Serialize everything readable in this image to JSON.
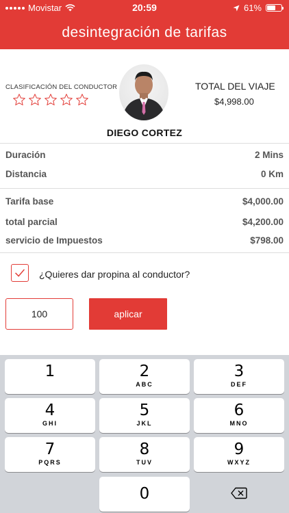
{
  "status_bar": {
    "carrier": "Movistar",
    "time": "20:59",
    "battery": "61%",
    "battery_level": 0.61
  },
  "header": {
    "title": "desintegración de tarifas"
  },
  "driver": {
    "rating_label": "CLASIFICACIÓN DEL CONDUCTOR",
    "rating": 0,
    "max_rating": 5,
    "name": "DIEGO CORTEZ"
  },
  "trip": {
    "total_label": "TOTAL DEL VIAJE",
    "total_value": "$4,998.00"
  },
  "details": [
    {
      "label": "Duración",
      "value": "2 Mins"
    },
    {
      "label": "Distancia",
      "value": "0 Km"
    }
  ],
  "fares": [
    {
      "label": "Tarifa base",
      "value": "$4,000.00"
    },
    {
      "label": "total parcial",
      "value": "$4,200.00"
    },
    {
      "label": "servicio de Impuestos",
      "value": "$798.00"
    }
  ],
  "tip": {
    "question": "¿Quieres dar propina al conductor?",
    "checked": true,
    "amount": "100",
    "apply_label": "aplicar"
  },
  "keypad": {
    "keys": [
      {
        "num": "1",
        "letters": ""
      },
      {
        "num": "2",
        "letters": "ABC"
      },
      {
        "num": "3",
        "letters": "DEF"
      },
      {
        "num": "4",
        "letters": "GHI"
      },
      {
        "num": "5",
        "letters": "JKL"
      },
      {
        "num": "6",
        "letters": "MNO"
      },
      {
        "num": "7",
        "letters": "PQRS"
      },
      {
        "num": "8",
        "letters": "TUV"
      },
      {
        "num": "9",
        "letters": "WXYZ"
      },
      {
        "num": "0",
        "letters": ""
      }
    ],
    "delete_icon": "backspace-icon"
  },
  "colors": {
    "brand_red": "#e23b36",
    "keypad_bg": "#d1d4d9"
  }
}
